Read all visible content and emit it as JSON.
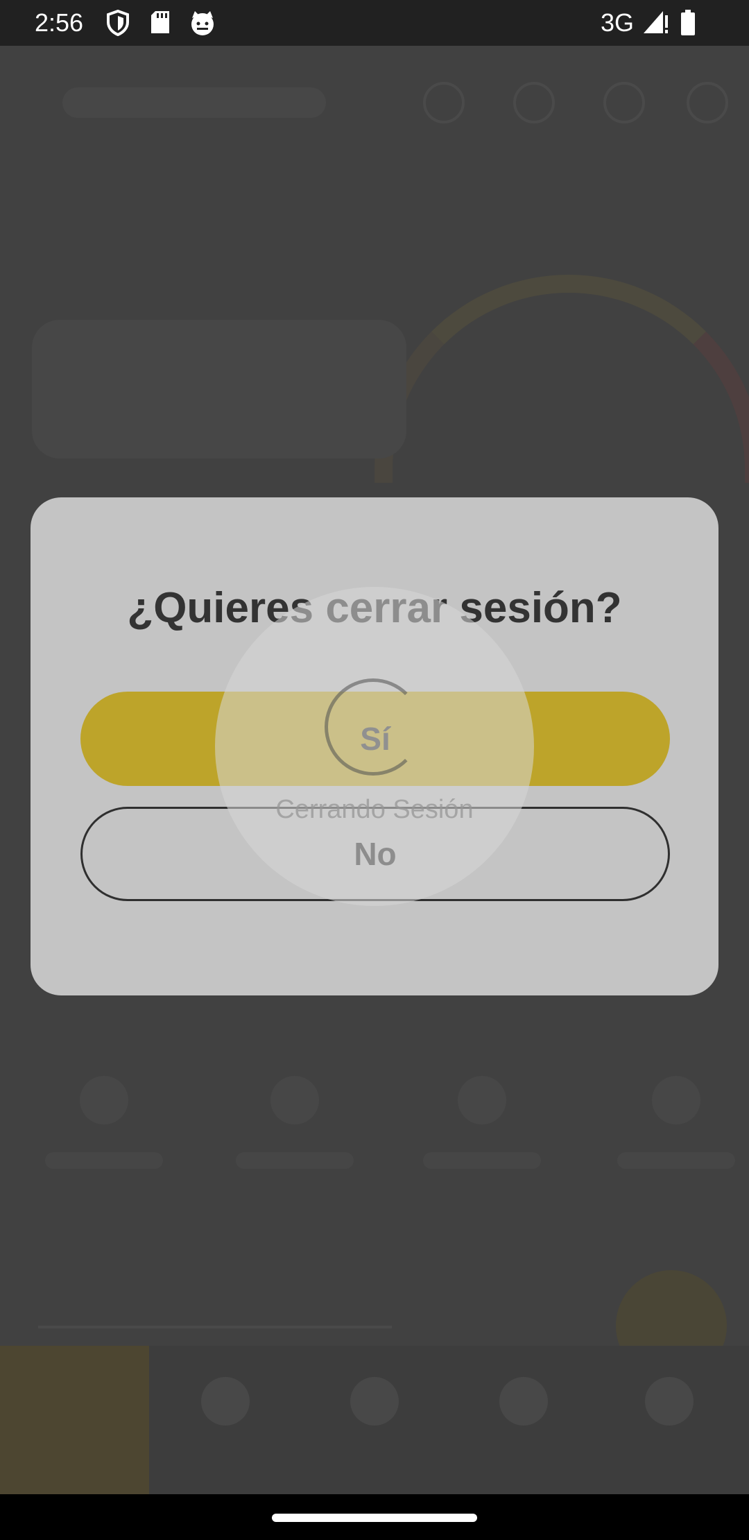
{
  "status_bar": {
    "time": "2:56",
    "network": "3G",
    "icons": [
      "shield-icon",
      "sd-card-icon",
      "cat-face-icon",
      "signal-icon",
      "battery-icon"
    ]
  },
  "dialog": {
    "title": "¿Quieres cerrar sesión?",
    "yes_label": "Sí",
    "no_label": "No",
    "yes_color": "#bda42a"
  },
  "loader": {
    "text": "Cerrando Sesión"
  },
  "colors": {
    "status_bar": "#212121",
    "dialog_bg": "#c4c4c4",
    "overlay": "#3d3d3d"
  }
}
